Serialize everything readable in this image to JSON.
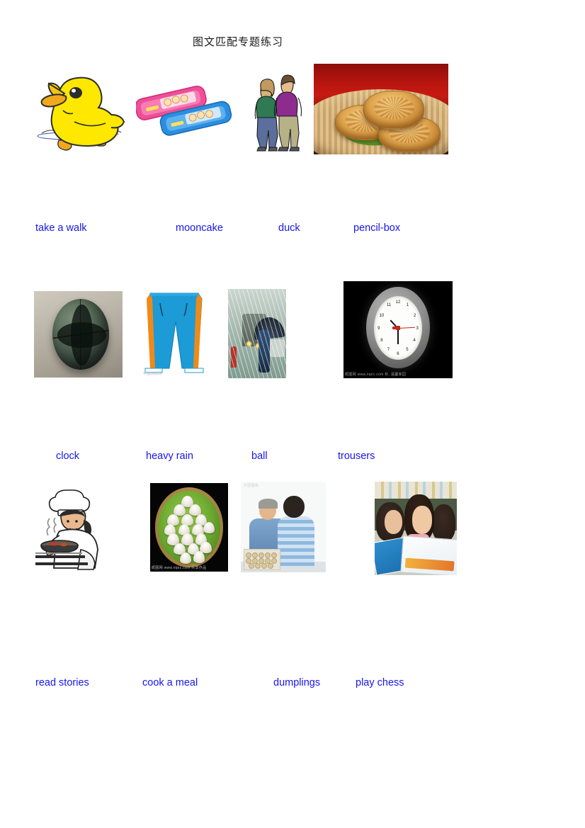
{
  "document": {
    "title": "图文匹配专题练习",
    "label_color": "#1715f0"
  },
  "rows": [
    {
      "pictures": [
        {
          "name": "duck-picture",
          "alt": "duck"
        },
        {
          "name": "pencil-box-picture",
          "alt": "pencil-box"
        },
        {
          "name": "take-a-walk-picture",
          "alt": "take a walk"
        },
        {
          "name": "mooncake-picture",
          "alt": "mooncake"
        }
      ],
      "labels": [
        "take a walk",
        "mooncake",
        "duck",
        "pencil-box"
      ]
    },
    {
      "pictures": [
        {
          "name": "ball-picture",
          "alt": "ball"
        },
        {
          "name": "trousers-picture",
          "alt": "trousers"
        },
        {
          "name": "heavy-rain-picture",
          "alt": "heavy rain"
        },
        {
          "name": "clock-picture",
          "alt": "clock"
        }
      ],
      "labels": [
        "clock",
        "heavy rain",
        "ball",
        "trousers"
      ]
    },
    {
      "pictures": [
        {
          "name": "cook-a-meal-picture",
          "alt": "cook a meal"
        },
        {
          "name": "dumplings-picture",
          "alt": "dumplings"
        },
        {
          "name": "play-chess-picture",
          "alt": "play chess"
        },
        {
          "name": "read-stories-picture",
          "alt": "read stories"
        }
      ],
      "labels": [
        "read stories",
        "cook a meal",
        "dumplings",
        "play chess"
      ]
    }
  ],
  "clock": {
    "numbers": [
      "12",
      "1",
      "2",
      "3",
      "4",
      "5",
      "6",
      "7",
      "8",
      "9",
      "10",
      "11"
    ],
    "watermark": "昵图网 www.nipic.com   秒, 温馨家园"
  },
  "watermarks": {
    "dumplings": "昵图网 www.nipic.com  共享作品",
    "trousers": "中国制造网",
    "chess": "中国图库"
  }
}
